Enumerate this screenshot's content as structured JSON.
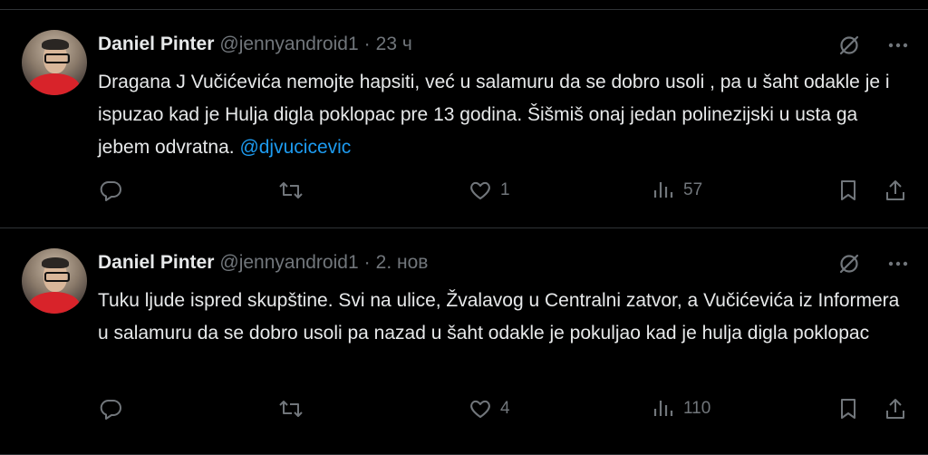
{
  "colors": {
    "background": "#000000",
    "text": "#e7e9ea",
    "muted": "#71767b",
    "link": "#1d9bf0",
    "divider": "#2f3336"
  },
  "icons": {
    "reply": "reply-icon",
    "retweet": "retweet-icon",
    "like": "heart-icon",
    "views": "views-icon",
    "bookmark": "bookmark-icon",
    "share": "share-icon",
    "grok": "grok-icon",
    "more": "more-icon"
  },
  "tweets": [
    {
      "display_name": "Daniel Pinter",
      "handle": "@jennyandroid1",
      "separator": "·",
      "time": "23 ч",
      "text": "Dragana J Vučićevića nemojte hapsiti,  već u salamuru da se dobro usoli , pa u šaht odakle je i ispuzao kad je Hulja digla poklopac pre 13 godina. Šišmiš onaj jedan polinezijski u usta ga jebem odvratna. ",
      "mention": "@djvucicevic",
      "replies": "",
      "retweets": "",
      "likes": "1",
      "views": "57"
    },
    {
      "display_name": "Daniel Pinter",
      "handle": "@jennyandroid1",
      "separator": "·",
      "time": "2. нов",
      "text": "Tuku ljude ispred skupštine.  Svi na ulice, Žvalavog u Centralni zatvor, a Vučićevića iz Informera u salamuru da se dobro usoli pa nazad u šaht odakle je pokuljao kad je hulja digla poklopac",
      "mention": "",
      "replies": "",
      "retweets": "",
      "likes": "4",
      "views": "110"
    }
  ]
}
